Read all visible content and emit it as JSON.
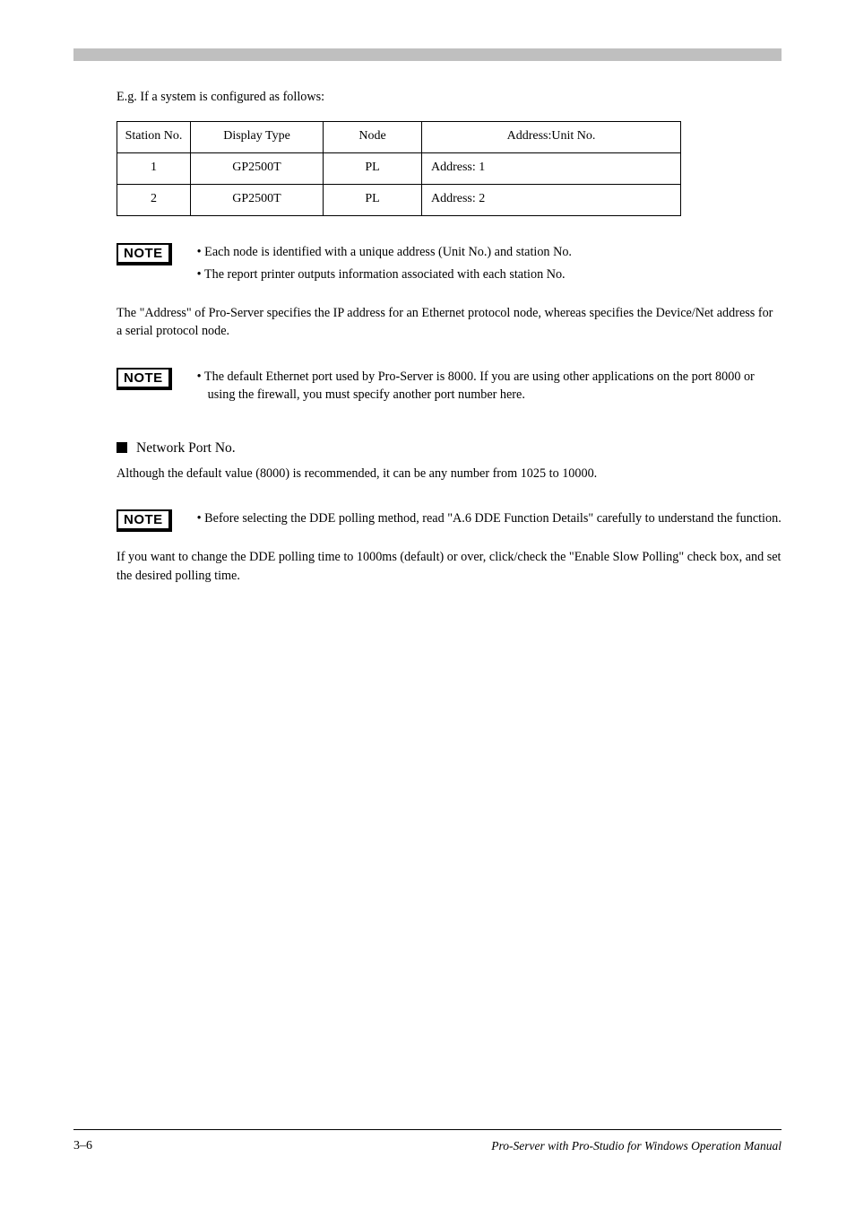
{
  "intro": "E.g. If a system is configured as follows:",
  "table": {
    "headers": [
      "Station No.",
      "Display Type",
      "Node",
      "Address:Unit No."
    ],
    "rows": [
      [
        "1",
        "GP2500T",
        "PL",
        "Address: 1"
      ],
      [
        "2",
        "GP2500T",
        "PL",
        "Address: 2"
      ]
    ]
  },
  "notes": [
    {
      "lines": [
        "• Each node is identified with a unique address (Unit No.) and station No.",
        "• The report printer outputs information associated with each station No."
      ]
    },
    {
      "lines": [
        "• The default Ethernet port used by Pro-Server is 8000. If you are using other applications on the port 8000 or using the firewall, you must specify another port number here."
      ]
    },
    {
      "lines": [
        "• Before selecting the DDE polling method, read \"A.6 DDE Function Details\" carefully to understand the function."
      ]
    }
  ],
  "paragraphs": {
    "p1": "The \"Address\" of Pro-Server specifies the IP address for an Ethernet protocol node, whereas specifies the Device/Net address for a serial protocol node.",
    "heading": "Network Port No.",
    "p2": "Although the default value (8000) is recommended, it can be any number from 1025 to 10000.",
    "p3": "If you want to change the DDE polling time to 1000ms (default) or over, click/check the \"Enable Slow Polling\" check box, and set the desired polling time."
  },
  "footer": {
    "left": "3–6",
    "right": "Pro-Server with Pro-Studio for Windows Operation Manual"
  }
}
